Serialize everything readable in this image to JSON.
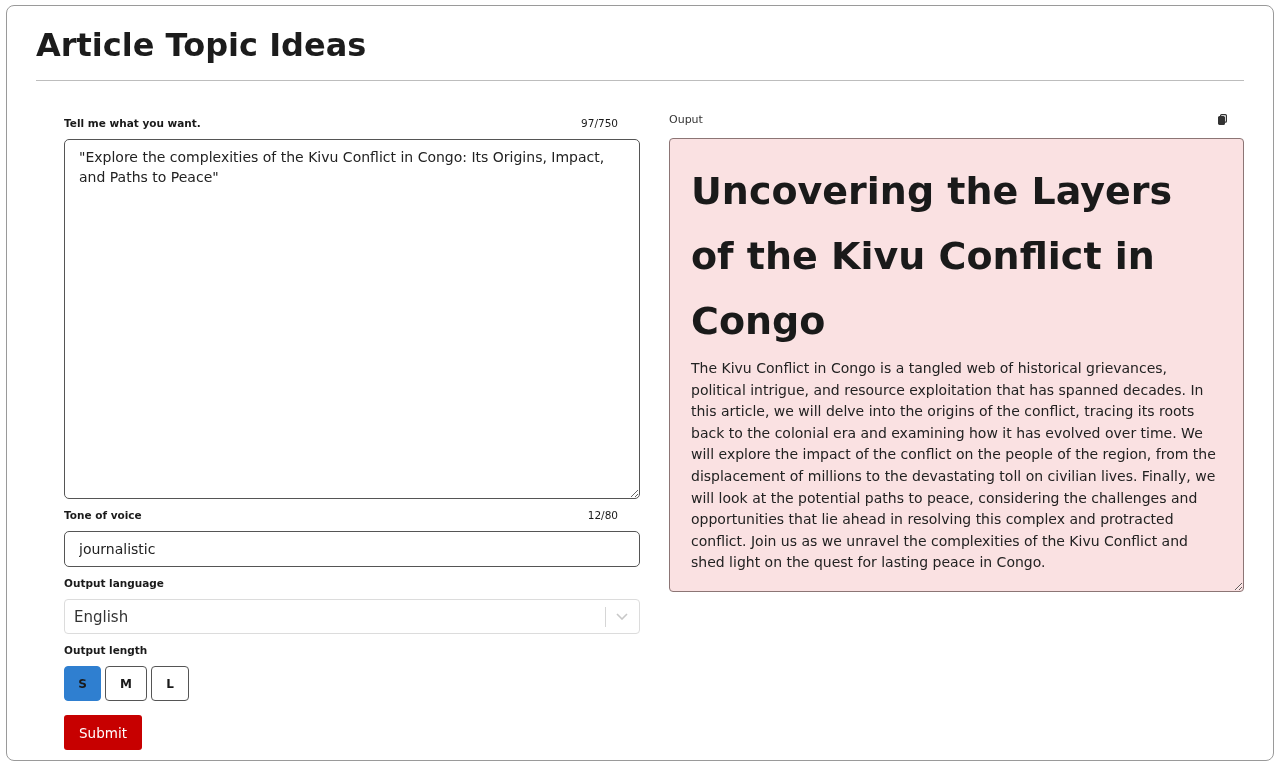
{
  "page": {
    "title": "Article Topic Ideas"
  },
  "prompt": {
    "label": "Tell me what you want.",
    "counter": "97/750",
    "value": "\"Explore the complexities of the Kivu Conflict in Congo: Its Origins, Impact, and Paths to Peace\""
  },
  "tone": {
    "label": "Tone of voice",
    "counter": "12/80",
    "value": "journalistic"
  },
  "language": {
    "label": "Output language",
    "value": "English"
  },
  "length": {
    "label": "Output length",
    "options": [
      {
        "label": "S",
        "selected": true
      },
      {
        "label": "M",
        "selected": false
      },
      {
        "label": "L",
        "selected": false
      }
    ]
  },
  "submit": {
    "label": "Submit"
  },
  "output": {
    "label": "Ouput",
    "heading": "Uncovering the Layers of the Kivu Conflict in Congo",
    "body": "The Kivu Conflict in Congo is a tangled web of historical grievances, political intrigue, and resource exploitation that has spanned decades. In this article, we will delve into the origins of the conflict, tracing its roots back to the colonial era and examining how it has evolved over time. We will explore the impact of the conflict on the people of the region, from the displacement of millions to the devastating toll on civilian lives. Finally, we will look at the potential paths to peace, considering the challenges and opportunities that lie ahead in resolving this complex and protracted conflict. Join us as we unravel the complexities of the Kivu Conflict and shed light on the quest for lasting peace in Congo."
  }
}
